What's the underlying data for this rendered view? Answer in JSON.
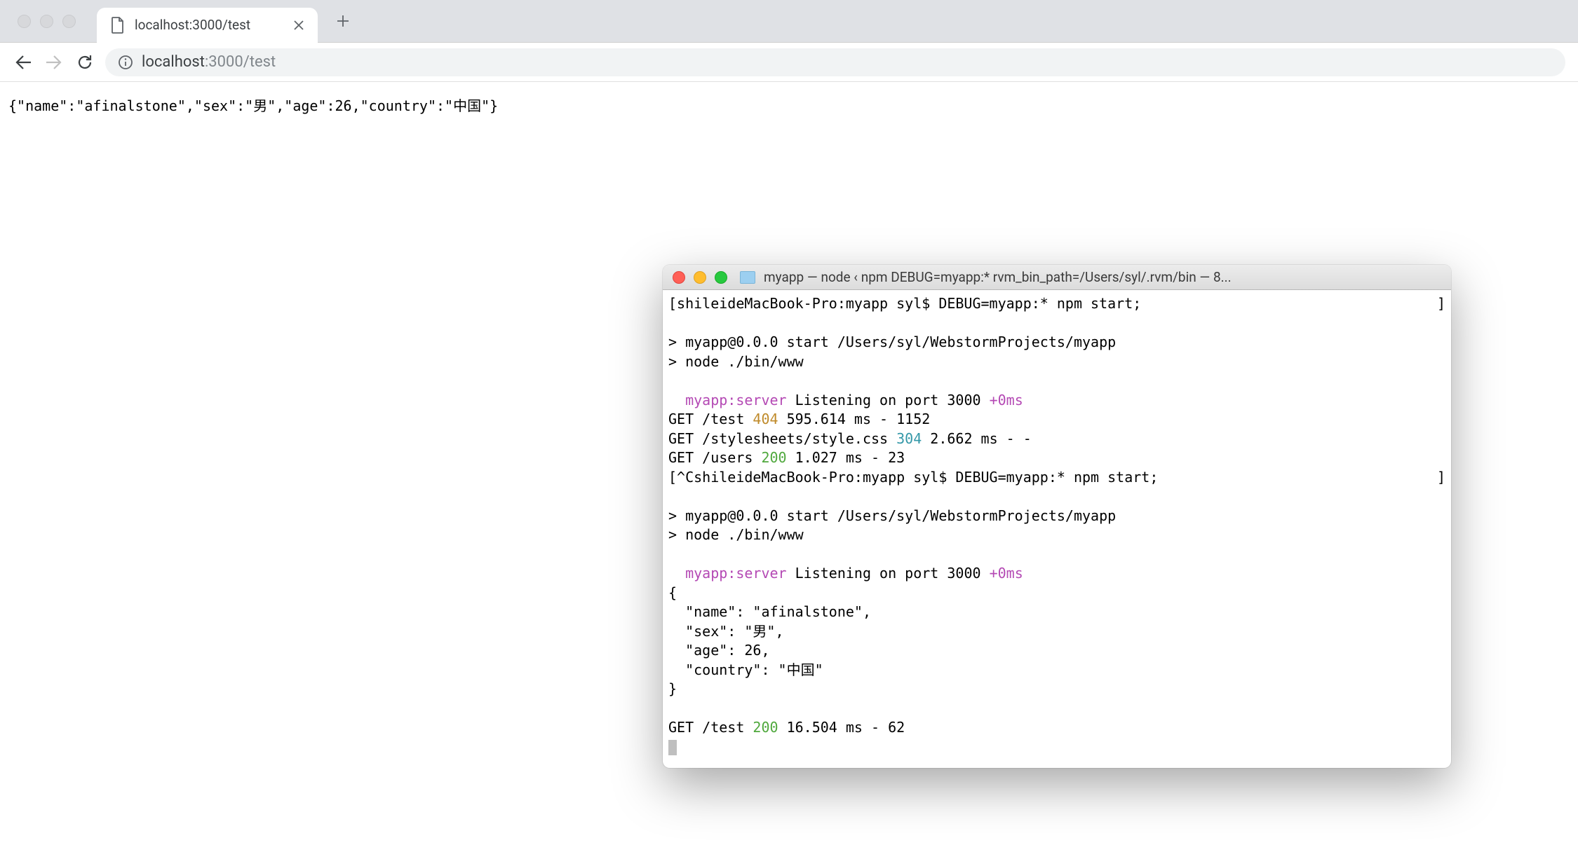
{
  "chrome": {
    "tab_title": "localhost:3000/test",
    "address_prefix": "localhost",
    "address_suffix": ":3000/test"
  },
  "page": {
    "body": "{\"name\":\"afinalstone\",\"sex\":\"男\",\"age\":26,\"country\":\"中国\"}"
  },
  "terminal": {
    "title": "myapp — node ‹ npm DEBUG=myapp:* rvm_bin_path=/Users/syl/.rvm/bin — 8...",
    "lines": {
      "l0a": "[shileideMacBook-Pro:myapp syl$ DEBUG=myapp:* npm start;",
      "l0b": "]",
      "l1": "",
      "l2": "> myapp@0.0.0 start /Users/syl/WebstormProjects/myapp",
      "l3": "> node ./bin/www",
      "l4": "",
      "l5a": "  ",
      "l5b": "myapp:server",
      "l5c": " Listening on port 3000 ",
      "l5d": "+0ms",
      "l6a": "GET /test ",
      "l6b": "404",
      "l6c": " 595.614 ms - 1152",
      "l7a": "GET /stylesheets/style.css ",
      "l7b": "304",
      "l7c": " 2.662 ms - -",
      "l8a": "GET /users ",
      "l8b": "200",
      "l8c": " 1.027 ms - 23",
      "l9a": "[^CshileideMacBook-Pro:myapp syl$ DEBUG=myapp:* npm start;",
      "l9b": "]",
      "l10": "",
      "l11": "> myapp@0.0.0 start /Users/syl/WebstormProjects/myapp",
      "l12": "> node ./bin/www",
      "l13": "",
      "l14a": "  ",
      "l14b": "myapp:server",
      "l14c": " Listening on port 3000 ",
      "l14d": "+0ms",
      "l15": "{",
      "l16": "  \"name\": \"afinalstone\",",
      "l17": "  \"sex\": \"男\",",
      "l18": "  \"age\": 26,",
      "l19": "  \"country\": \"中国\"",
      "l20": "}",
      "l21": "",
      "l22a": "GET /test ",
      "l22b": "200",
      "l22c": " 16.504 ms - 62"
    }
  }
}
